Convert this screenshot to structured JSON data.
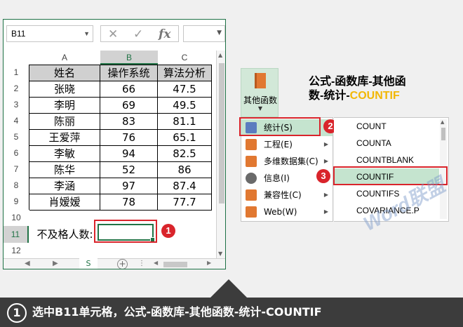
{
  "formula_bar": {
    "name_box": "B11",
    "icons": [
      "close-icon",
      "check-icon",
      "fx-icon"
    ],
    "fx_label": "fx"
  },
  "columns": [
    "A",
    "B",
    "C"
  ],
  "rows": [
    "1",
    "2",
    "3",
    "4",
    "5",
    "6",
    "7",
    "8",
    "9",
    "10",
    "11",
    "12"
  ],
  "table": {
    "headers": [
      "姓名",
      "操作系统",
      "算法分析"
    ],
    "rows": [
      [
        "张晓",
        "66",
        "47.5"
      ],
      [
        "李明",
        "69",
        "49.5"
      ],
      [
        "陈丽",
        "83",
        "81.1"
      ],
      [
        "王爱萍",
        "76",
        "65.1"
      ],
      [
        "李敏",
        "94",
        "82.5"
      ],
      [
        "陈华",
        "52",
        "86"
      ],
      [
        "李涵",
        "97",
        "87.4"
      ],
      [
        "肖嫒嫒",
        "78",
        "77.7"
      ]
    ]
  },
  "row11_label": "不及格人数:",
  "sheet_tab": "S",
  "ribbon": {
    "button_label": "其他函数",
    "icon": "function-book-icon"
  },
  "title": {
    "line1": "公式-函数库-其他函",
    "line2_prefix": "数-统计-",
    "line2_accent": "COUNTIF"
  },
  "menu": [
    {
      "label": "统计(S)",
      "icon": "statistics-icon",
      "highlighted": true
    },
    {
      "label": "工程(E)",
      "icon": "engineering-icon"
    },
    {
      "label": "多维数据集(C)",
      "icon": "cube-icon"
    },
    {
      "label": "信息(I)",
      "icon": "info-icon"
    },
    {
      "label": "兼容性(C)",
      "icon": "compatibility-icon"
    },
    {
      "label": "Web(W)",
      "icon": "web-icon"
    }
  ],
  "functions": [
    "COUNT",
    "COUNTA",
    "COUNTBLANK",
    "COUNTIF",
    "COUNTIFS",
    "COVARIANCE.P"
  ],
  "badges": [
    "1",
    "2",
    "3"
  ],
  "watermark": "Word联盟",
  "caption": {
    "number": "1",
    "text": "选中B11单元格，公式-函数库-其他函数-统计-COUNTIF"
  },
  "colors": {
    "excel_green": "#217346",
    "red": "#d9242b",
    "accent_yellow": "#f2b705",
    "menu_highlight": "#c5e4cf"
  }
}
